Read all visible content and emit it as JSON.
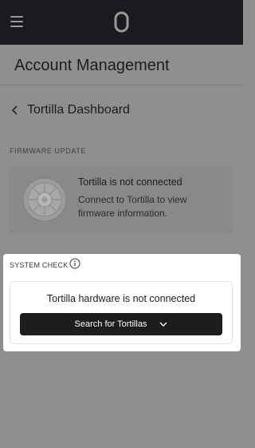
{
  "header": {
    "menu_icon": "hamburger-menu-icon",
    "logo": "zero-logo-icon"
  },
  "page": {
    "title": "Account Management",
    "breadcrumb": "Tortilla Dashboard"
  },
  "firmware": {
    "section_label": "FIRMWARE UPDATE",
    "title": "Tortilla is not connected",
    "description": "Connect to Tortilla to view firmware information.",
    "icon": "gear-icon"
  },
  "system_check": {
    "section_label": "SYSTEM CHECK",
    "info_icon": "info-icon",
    "status": "Tortilla hardware is not connected",
    "button_label": "Search for Tortillas",
    "button_icon": "chevron-down-icon"
  },
  "colors": {
    "topbar": "#1b1b1f",
    "overlay": "#8f8f8f",
    "button": "#1d1d20",
    "highlight_panel": "#ffffff"
  }
}
